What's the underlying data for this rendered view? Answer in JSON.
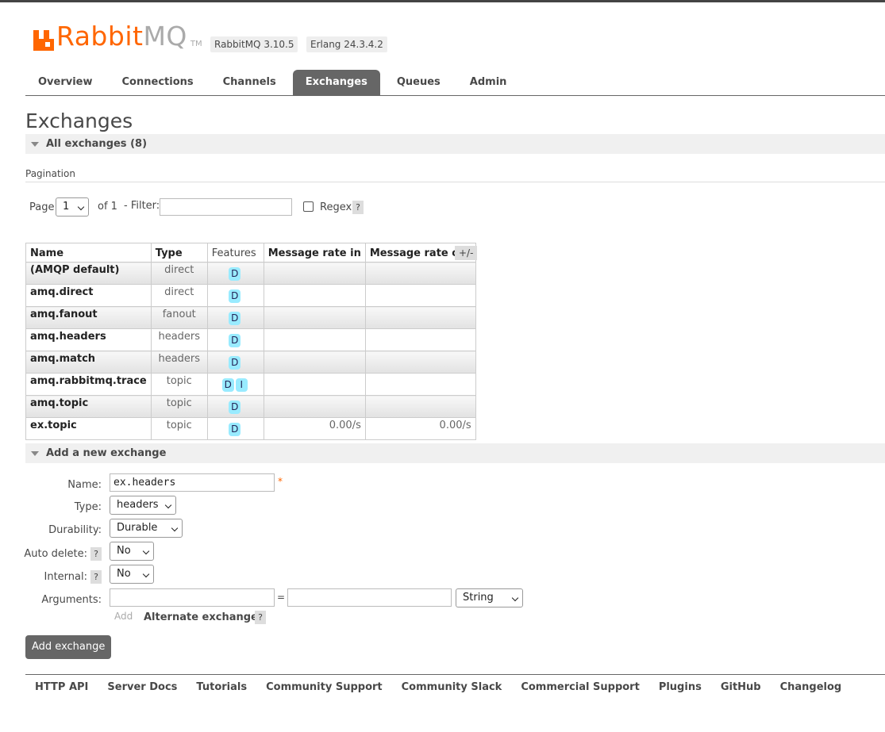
{
  "header": {
    "logo_text_brand": "Rabbit",
    "logo_text_mq": "MQ",
    "logo_tm": "TM",
    "version": "RabbitMQ 3.10.5",
    "erlang": "Erlang 24.3.4.2"
  },
  "tabs": [
    {
      "label": "Overview"
    },
    {
      "label": "Connections"
    },
    {
      "label": "Channels"
    },
    {
      "label": "Exchanges",
      "active": true
    },
    {
      "label": "Queues"
    },
    {
      "label": "Admin"
    }
  ],
  "page_title": "Exchanges",
  "all_exchanges": {
    "heading": "All exchanges (8)",
    "pagination_label": "Pagination",
    "page_label": "Page",
    "page_value": "1",
    "of_label": "of 1",
    "filter_label": "- Filter:",
    "filter_value": "",
    "regex_label": "Regex",
    "help": "?"
  },
  "table": {
    "columns": [
      "Name",
      "Type",
      "Features",
      "Message rate in",
      "Message rate out"
    ],
    "toggle": "+/-",
    "rows": [
      {
        "name": "(AMQP default)",
        "type": "direct",
        "features": [
          "D"
        ],
        "rate_in": "",
        "rate_out": ""
      },
      {
        "name": "amq.direct",
        "type": "direct",
        "features": [
          "D"
        ],
        "rate_in": "",
        "rate_out": ""
      },
      {
        "name": "amq.fanout",
        "type": "fanout",
        "features": [
          "D"
        ],
        "rate_in": "",
        "rate_out": ""
      },
      {
        "name": "amq.headers",
        "type": "headers",
        "features": [
          "D"
        ],
        "rate_in": "",
        "rate_out": ""
      },
      {
        "name": "amq.match",
        "type": "headers",
        "features": [
          "D"
        ],
        "rate_in": "",
        "rate_out": ""
      },
      {
        "name": "amq.rabbitmq.trace",
        "type": "topic",
        "features": [
          "D",
          "I"
        ],
        "rate_in": "",
        "rate_out": ""
      },
      {
        "name": "amq.topic",
        "type": "topic",
        "features": [
          "D"
        ],
        "rate_in": "",
        "rate_out": ""
      },
      {
        "name": "ex.topic",
        "type": "topic",
        "features": [
          "D"
        ],
        "rate_in": "0.00/s",
        "rate_out": "0.00/s"
      }
    ]
  },
  "add_exchange": {
    "heading": "Add a new exchange",
    "name_label": "Name:",
    "name_value": "ex.headers",
    "required_mark": "*",
    "type_label": "Type:",
    "type_value": "headers",
    "durability_label": "Durability:",
    "durability_value": "Durable",
    "auto_delete_label": "Auto delete:",
    "auto_delete_value": "No",
    "internal_label": "Internal:",
    "internal_value": "No",
    "arguments_label": "Arguments:",
    "arg_key": "",
    "arg_equals": "=",
    "arg_value": "",
    "arg_type": "String",
    "add_link": "Add",
    "alternate_exchange": "Alternate exchange",
    "help": "?",
    "submit": "Add exchange"
  },
  "footer": [
    "HTTP API",
    "Server Docs",
    "Tutorials",
    "Community Support",
    "Community Slack",
    "Commercial Support",
    "Plugins",
    "GitHub",
    "Changelog"
  ]
}
